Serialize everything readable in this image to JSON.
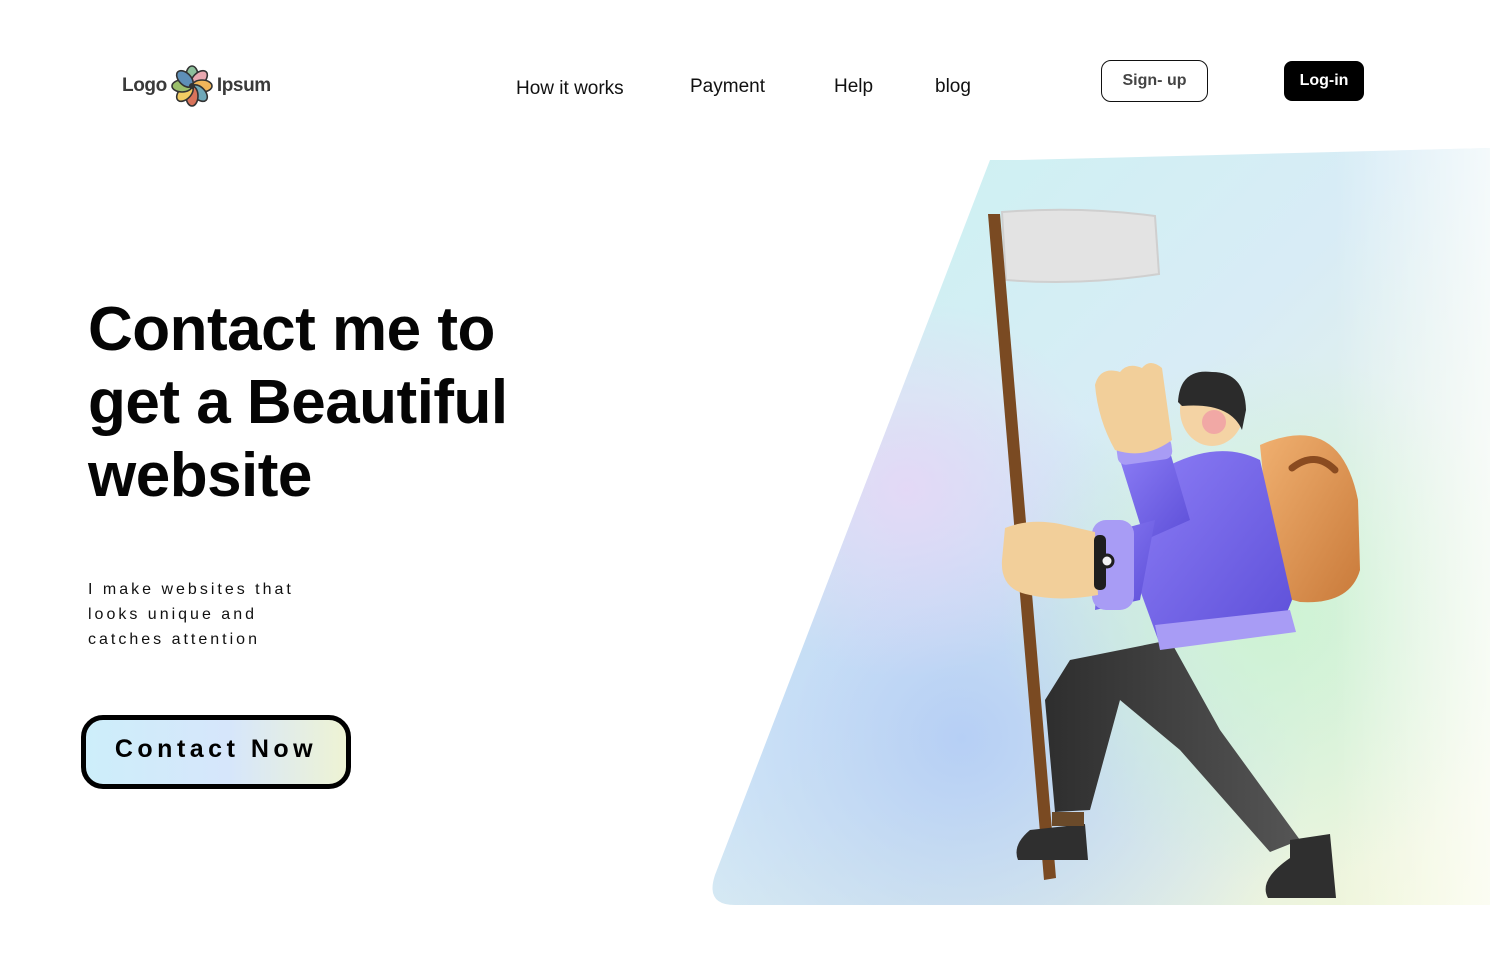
{
  "header": {
    "logo": {
      "left_text": "Logo",
      "right_text": "Ipsum",
      "mark_icon": "flower-logo-icon"
    },
    "nav": [
      {
        "label": "How it works"
      },
      {
        "label": "Payment"
      },
      {
        "label": "Help"
      },
      {
        "label": "blog"
      }
    ],
    "signup_label": "Sign- up",
    "login_label": "Log-in"
  },
  "hero": {
    "title_lines": [
      "Contact me to",
      "get a Beautiful",
      "website"
    ],
    "subtitle_lines": [
      "I make websites that",
      "looks unique and",
      "catches attention"
    ],
    "cta_label": "Contact Now"
  },
  "illustration": {
    "icon": "hiker-with-flag-illustration",
    "panel_gradient_colors": [
      "#c9f3f0",
      "#e7dcf5",
      "#bcd3f4",
      "#d4f3d9",
      "#f3f7d6"
    ],
    "character_colors": {
      "hoodie": "#7b6cf0",
      "backpack": "#d89152",
      "pants": "#3c3c3c",
      "skin": "#f2cf9a",
      "flag": "#e4e4e4",
      "pole": "#7a4a22"
    }
  },
  "colors": {
    "text": "#0a0a0a",
    "button_dark": "#000000",
    "background": "#ffffff"
  }
}
